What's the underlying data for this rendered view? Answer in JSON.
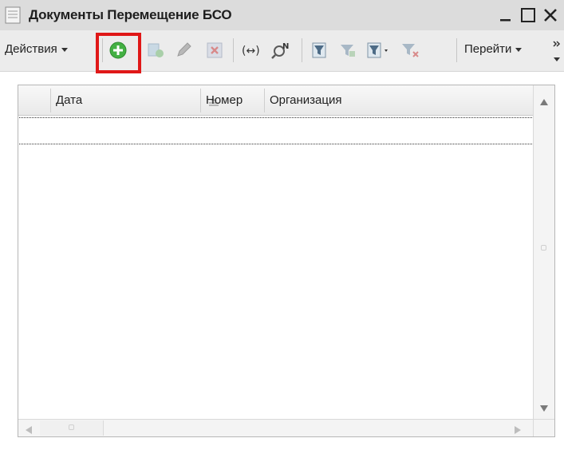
{
  "window": {
    "title": "Документы Перемещение БСО"
  },
  "toolbar": {
    "actions_label": "Действия",
    "goto_label": "Перейти",
    "icons": [
      {
        "name": "add-icon",
        "color": "#3aa83a"
      },
      {
        "name": "copy-icon"
      },
      {
        "name": "edit-icon"
      },
      {
        "name": "delete-icon"
      },
      {
        "name": "hierarchy-icon",
        "text": "(↔)"
      },
      {
        "name": "find-icon"
      },
      {
        "name": "filter-icon"
      },
      {
        "name": "filter-by-value-icon"
      },
      {
        "name": "filter-history-icon"
      },
      {
        "name": "clear-filter-icon"
      }
    ],
    "highlight_color": "#e01818"
  },
  "table": {
    "columns": [
      "Дата",
      "Номер",
      "Организация"
    ],
    "sorted_column": "Дата",
    "rows": []
  }
}
